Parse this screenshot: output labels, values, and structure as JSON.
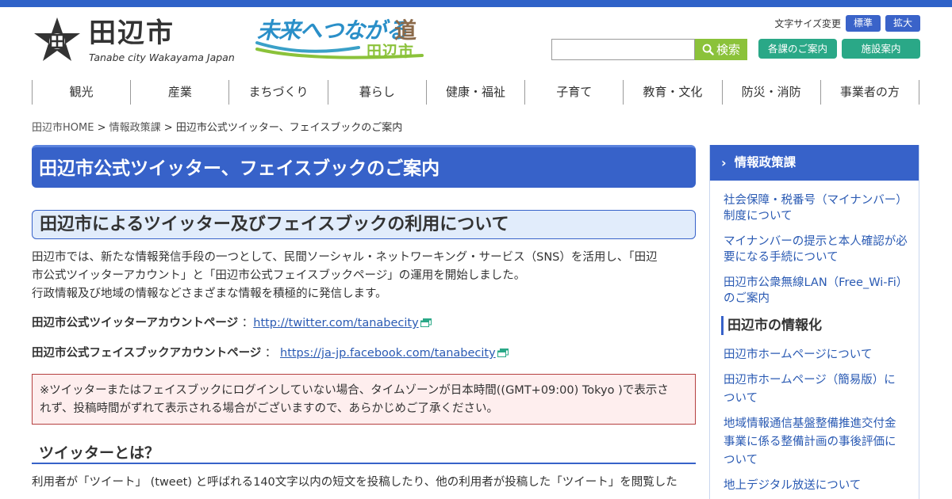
{
  "header": {
    "logo_name": "田辺市",
    "logo_sub": "Tanabe city Wakayama Japan",
    "slogan_main": "未来へつながる",
    "slogan_road": "道",
    "slogan_city": "田辺市",
    "fontsize_label": "文字サイズ変更",
    "fontsize_normal": "標準",
    "fontsize_large": "拡大",
    "search_placeholder": "",
    "search_button": "検索",
    "dept_button": "各課のご案内",
    "facility_button": "施設案内"
  },
  "colors": {
    "primary_blue": "#3762c9",
    "green": "#8bc23a",
    "teal": "#2aa887",
    "notice_bg": "#feeeee"
  },
  "nav": {
    "items": [
      {
        "label": "観光"
      },
      {
        "label": "産業"
      },
      {
        "label": "まちづくり"
      },
      {
        "label": "暮らし"
      },
      {
        "label": "健康・福祉"
      },
      {
        "label": "子育て"
      },
      {
        "label": "教育・文化"
      },
      {
        "label": "防災・消防"
      },
      {
        "label": "事業者の方"
      }
    ]
  },
  "breadcrumb": {
    "home": "田辺市HOME",
    "sep1": " > ",
    "dept": "情報政策課",
    "sep2": " > ",
    "current": "田辺市公式ツイッター、フェイスブックのご案内"
  },
  "main": {
    "page_title": "田辺市公式ツイッター、フェイスブックのご案内",
    "section_title": "田辺市によるツイッター及びフェイスブックの利用について",
    "intro_line1": "田辺市では、新たな情報発信手段の一つとして、民間ソーシャル・ネットワーキング・サービス（SNS）を活用し、「田辺",
    "intro_line2": "市公式ツイッターアカウント」と「田辺市公式フェイスブックページ」の運用を開始しました。",
    "intro_line3": "行政情報及び地域の情報などさまざまな情報を積極的に発信します。",
    "twitter_label": "田辺市公式ツイッターアカウントページ",
    "twitter_sep": " ：",
    "twitter_url": "http://twitter.com/tanabecity",
    "facebook_label": "田辺市公式フェイスブックアカウントページ",
    "facebook_sep": " ： ",
    "facebook_url": "https://ja-jp.facebook.com/tanabecity",
    "notice_line1": "※ツイッターまたはフェイスブックにログインしていない場合、タイムゾーンが日本時間((GMT+09:00) Tokyo )で表示さ",
    "notice_line2": "れず、投稿時間がずれて表示される場合がございますので、あらかじめご了承ください。",
    "twitter_heading": "ツイッターとは？",
    "twitter_body": "利用者が「ツイート」 (tweet) と呼ばれる140文字以内の短文を投稿したり、他の利用者が投稿した「ツイート」を閲覧した"
  },
  "sidebar": {
    "heading": "情報政策課",
    "links": [
      {
        "line1": "社会保障・税番号（マイナンバー）",
        "line2": "制度について"
      },
      {
        "line1": "マイナンバーの提示と本人確認が必",
        "line2": "要になる手続について"
      },
      {
        "line1": "田辺市公衆無線LAN（Free_Wi-Fi）",
        "line2": "のご案内"
      }
    ],
    "sub_heading": "田辺市の情報化",
    "links2": [
      {
        "line1": "田辺市ホームページについて"
      },
      {
        "line1": "田辺市ホームページ（簡易版）に",
        "line2": "ついて"
      },
      {
        "line1": "地域情報通信基盤整備推進交付金",
        "line2": "事業に係る整備計画の事後評価に",
        "line3": "ついて"
      },
      {
        "line1": "地上デジタル放送について"
      }
    ]
  }
}
